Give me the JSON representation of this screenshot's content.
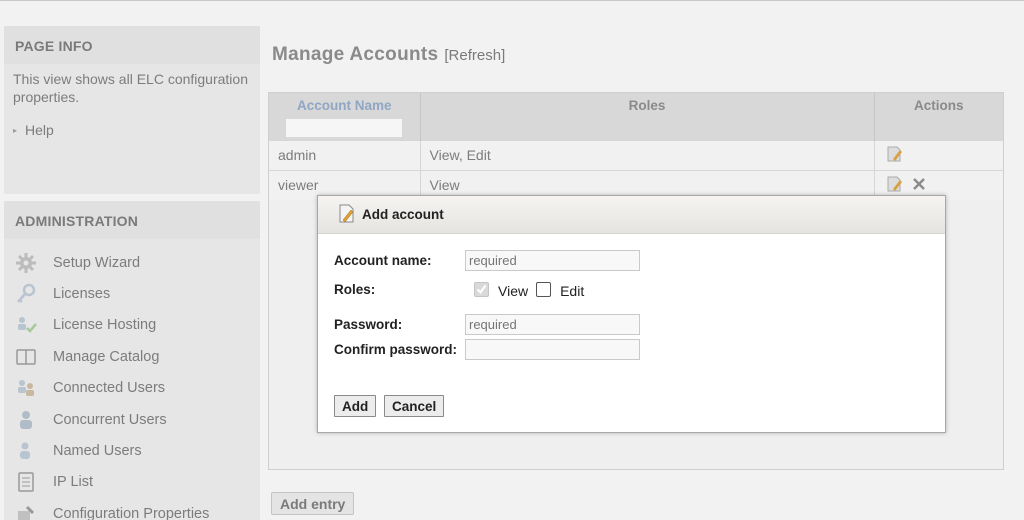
{
  "sidebar": {
    "page_info": {
      "title": "PAGE INFO",
      "description": "This view shows all ELC configuration properties.",
      "help_label": "Help"
    },
    "administration": {
      "title": "ADMINISTRATION",
      "items": [
        {
          "label": "Setup Wizard",
          "icon": "gear-icon"
        },
        {
          "label": "Licenses",
          "icon": "key-icon"
        },
        {
          "label": "License Hosting",
          "icon": "hosting-icon"
        },
        {
          "label": "Manage Catalog",
          "icon": "book-icon"
        },
        {
          "label": "Connected Users",
          "icon": "users-icon"
        },
        {
          "label": "Concurrent Users",
          "icon": "concurrent-users-icon"
        },
        {
          "label": "Named Users",
          "icon": "named-user-icon"
        },
        {
          "label": "IP List",
          "icon": "list-icon"
        },
        {
          "label": "Configuration Properties",
          "icon": "config-icon"
        }
      ]
    }
  },
  "main": {
    "title": "Manage Accounts",
    "refresh_label": "[Refresh]",
    "table": {
      "columns": [
        "Account Name",
        "Roles",
        "Actions"
      ],
      "rows": [
        {
          "account": "admin",
          "roles": "View, Edit",
          "actions": [
            "edit-icon"
          ]
        },
        {
          "account": "viewer",
          "roles": "View",
          "actions": [
            "edit-icon",
            "delete-icon"
          ]
        }
      ]
    },
    "add_entry_label": "Add entry"
  },
  "dialog": {
    "title": "Add account",
    "fields": {
      "account_name": {
        "label": "Account name:",
        "placeholder": "required",
        "value": ""
      },
      "roles": {
        "label": "Roles:",
        "options": [
          {
            "label": "View",
            "checked": true,
            "disabled": true
          },
          {
            "label": "Edit",
            "checked": false
          }
        ]
      },
      "password": {
        "label": "Password:",
        "placeholder": "required",
        "value": ""
      },
      "confirm_password": {
        "label": "Confirm password:",
        "placeholder": "",
        "value": ""
      }
    },
    "add_label": "Add",
    "cancel_label": "Cancel"
  }
}
